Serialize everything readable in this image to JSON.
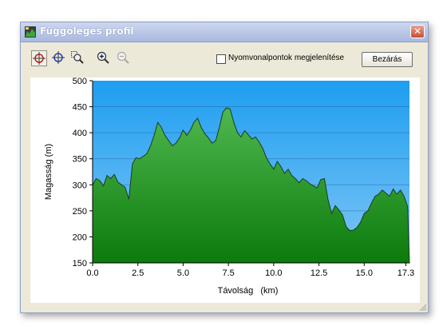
{
  "window": {
    "title": "Függőleges profil",
    "close_glyph": "✕"
  },
  "toolbar": {
    "tools": [
      {
        "icon": "crosshair-red-icon",
        "selected": true
      },
      {
        "icon": "crosshair-blue-icon",
        "selected": false
      },
      {
        "icon": "zoom-rect-icon",
        "selected": false
      },
      {
        "icon": "zoom-in-icon",
        "selected": false
      },
      {
        "icon": "zoom-out-icon",
        "selected": false,
        "disabled": true
      }
    ],
    "checkbox_label": "Nyomvonalpontok megjelenítése",
    "checkbox_checked": false,
    "close_label": "Bezárás"
  },
  "colors": {
    "sky_top": "#1e9ef0",
    "sky_bottom": "#7fc6f6",
    "terrain_top": "#4fb84f",
    "terrain_bottom": "#0c7a0c",
    "terrain_outline": "#1f3a1f"
  },
  "chart_data": {
    "type": "area",
    "xlabel": "Távolság   (km)",
    "ylabel": "Magasság (m)",
    "xlim": [
      0,
      17.5
    ],
    "ylim": [
      150,
      500
    ],
    "xticks": [
      "0.0",
      "2.5",
      "5.0",
      "7.5",
      "10.0",
      "12.5",
      "15.0",
      "17.3"
    ],
    "xtick_values": [
      0,
      2.5,
      5.0,
      7.5,
      10.0,
      12.5,
      15.0,
      17.3
    ],
    "yticks": [
      150,
      200,
      250,
      300,
      350,
      400,
      450,
      500
    ],
    "grid": true,
    "x": [
      0,
      0.2,
      0.4,
      0.6,
      0.8,
      1.0,
      1.2,
      1.4,
      1.6,
      1.8,
      2.0,
      2.2,
      2.4,
      2.6,
      2.8,
      3.0,
      3.2,
      3.4,
      3.6,
      3.8,
      4.0,
      4.2,
      4.4,
      4.6,
      4.8,
      5.0,
      5.2,
      5.4,
      5.6,
      5.8,
      6.0,
      6.2,
      6.4,
      6.6,
      6.8,
      7.0,
      7.2,
      7.4,
      7.6,
      7.8,
      8.0,
      8.2,
      8.4,
      8.6,
      8.8,
      9.0,
      9.2,
      9.4,
      9.6,
      9.8,
      10.0,
      10.2,
      10.4,
      10.6,
      10.8,
      11.0,
      11.2,
      11.4,
      11.6,
      11.8,
      12.0,
      12.2,
      12.4,
      12.6,
      12.8,
      13.0,
      13.2,
      13.4,
      13.6,
      13.8,
      14.0,
      14.2,
      14.4,
      14.6,
      14.8,
      15.0,
      15.2,
      15.4,
      15.6,
      15.8,
      16.0,
      16.2,
      16.4,
      16.6,
      16.8,
      17.0,
      17.2,
      17.4
    ],
    "y": [
      300,
      312,
      308,
      298,
      318,
      312,
      320,
      305,
      300,
      295,
      272,
      340,
      352,
      350,
      355,
      360,
      375,
      395,
      420,
      410,
      395,
      385,
      375,
      380,
      390,
      405,
      395,
      405,
      420,
      428,
      410,
      398,
      390,
      380,
      385,
      410,
      440,
      448,
      445,
      420,
      400,
      392,
      404,
      396,
      388,
      392,
      382,
      370,
      352,
      340,
      330,
      345,
      335,
      322,
      330,
      318,
      312,
      304,
      312,
      308,
      302,
      298,
      294,
      310,
      312,
      272,
      245,
      260,
      252,
      242,
      220,
      212,
      213,
      218,
      228,
      245,
      250,
      265,
      278,
      282,
      290,
      284,
      278,
      292,
      282,
      290,
      278,
      258
    ]
  }
}
